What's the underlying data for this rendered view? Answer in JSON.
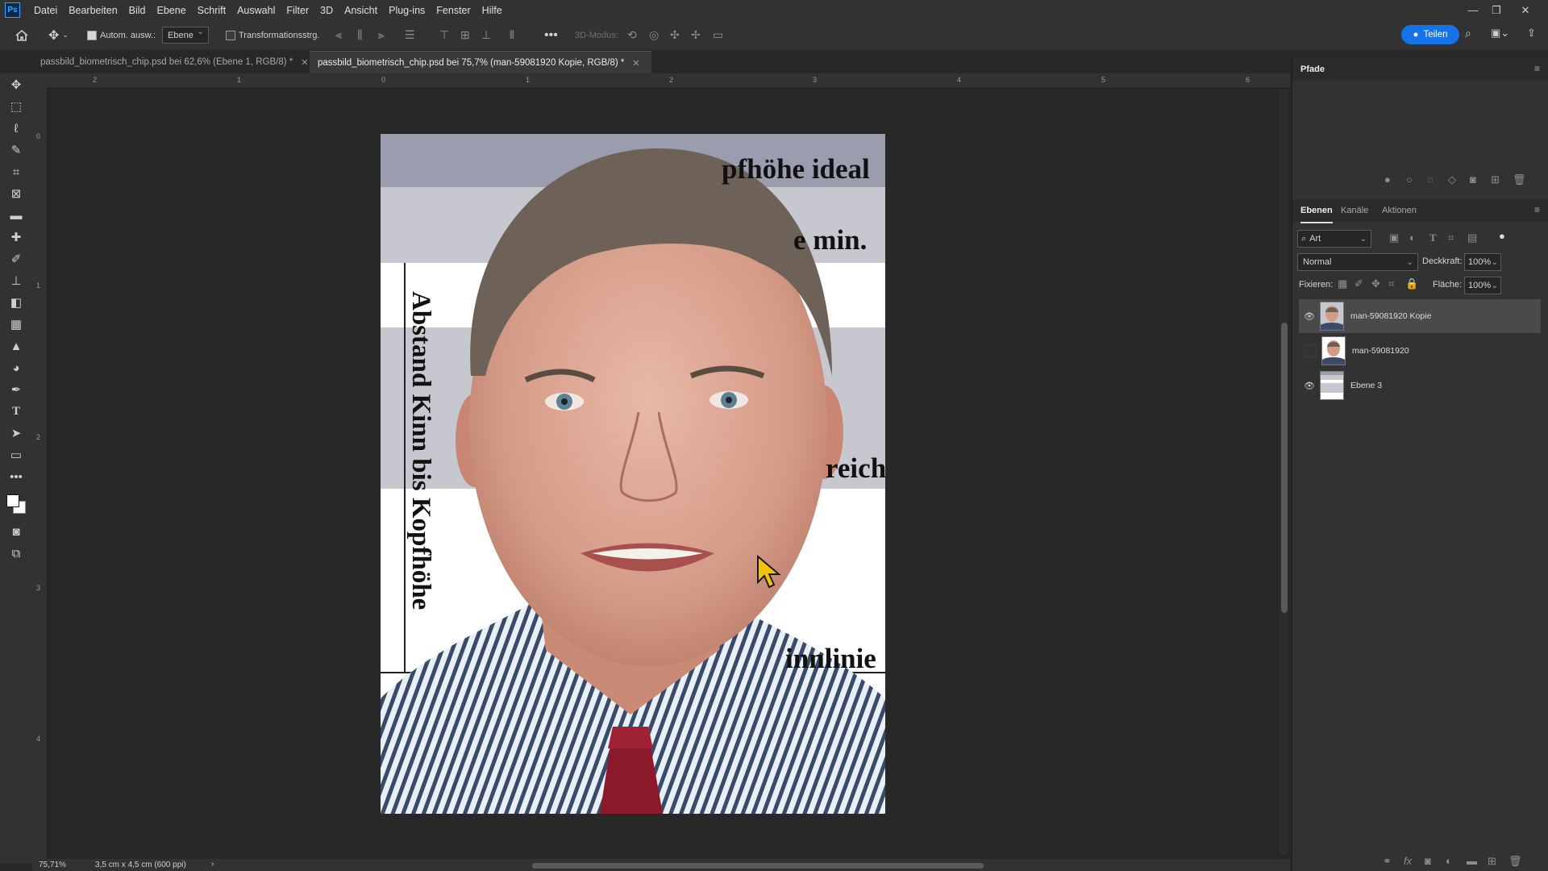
{
  "app": {
    "logo": "Ps",
    "menu": [
      "Datei",
      "Bearbeiten",
      "Bild",
      "Ebene",
      "Schrift",
      "Auswahl",
      "Filter",
      "3D",
      "Ansicht",
      "Plug-ins",
      "Fenster",
      "Hilfe"
    ]
  },
  "options": {
    "auto_select_label": "Autom. ausw.:",
    "auto_select_value": "Ebene",
    "transform_label": "Transformationsstrg.",
    "mode_3d_label": "3D-Modus:",
    "share_label": "Teilen"
  },
  "tabs": [
    {
      "label": "passbild_biometrisch_chip.psd bei 62,6% (Ebene 1, RGB/8) *"
    },
    {
      "label": "passbild_biometrisch_chip.psd bei 75,7% (man-59081920 Kopie, RGB/8) *"
    }
  ],
  "ruler": {
    "top": [
      "2",
      "1",
      "0",
      "1",
      "2",
      "3",
      "4",
      "5",
      "6"
    ],
    "left": [
      "0",
      "1",
      "2",
      "3",
      "4"
    ]
  },
  "canvas": {
    "labels": {
      "kopfhoehe_ideal": "pfhöhe ideal",
      "min": "e min.",
      "bereich": "reich",
      "kinnlinie": "innlinie",
      "vertical": "Abstand Kinn bis Kopfhöhe"
    }
  },
  "panels": {
    "paths_title": "Pfade",
    "layer_tabs": [
      "Ebenen",
      "Kanäle",
      "Aktionen"
    ],
    "filter_kind": "Art",
    "blend_mode": "Normal",
    "opacity_label": "Deckkraft:",
    "opacity_value": "100%",
    "lock_label": "Fixieren:",
    "fill_label": "Fläche:",
    "fill_value": "100%",
    "layers": [
      {
        "name": "man-59081920 Kopie",
        "visible": true,
        "selected": true
      },
      {
        "name": "man-59081920",
        "visible": false,
        "selected": false
      },
      {
        "name": "Ebene 3",
        "visible": true,
        "selected": false
      }
    ]
  },
  "status": {
    "zoom": "75,71%",
    "doc_size": "3,5 cm x 4,5 cm (600 ppi)"
  },
  "colors": {
    "accent": "#1473e6",
    "panel": "#323232",
    "workspace": "#282828"
  }
}
